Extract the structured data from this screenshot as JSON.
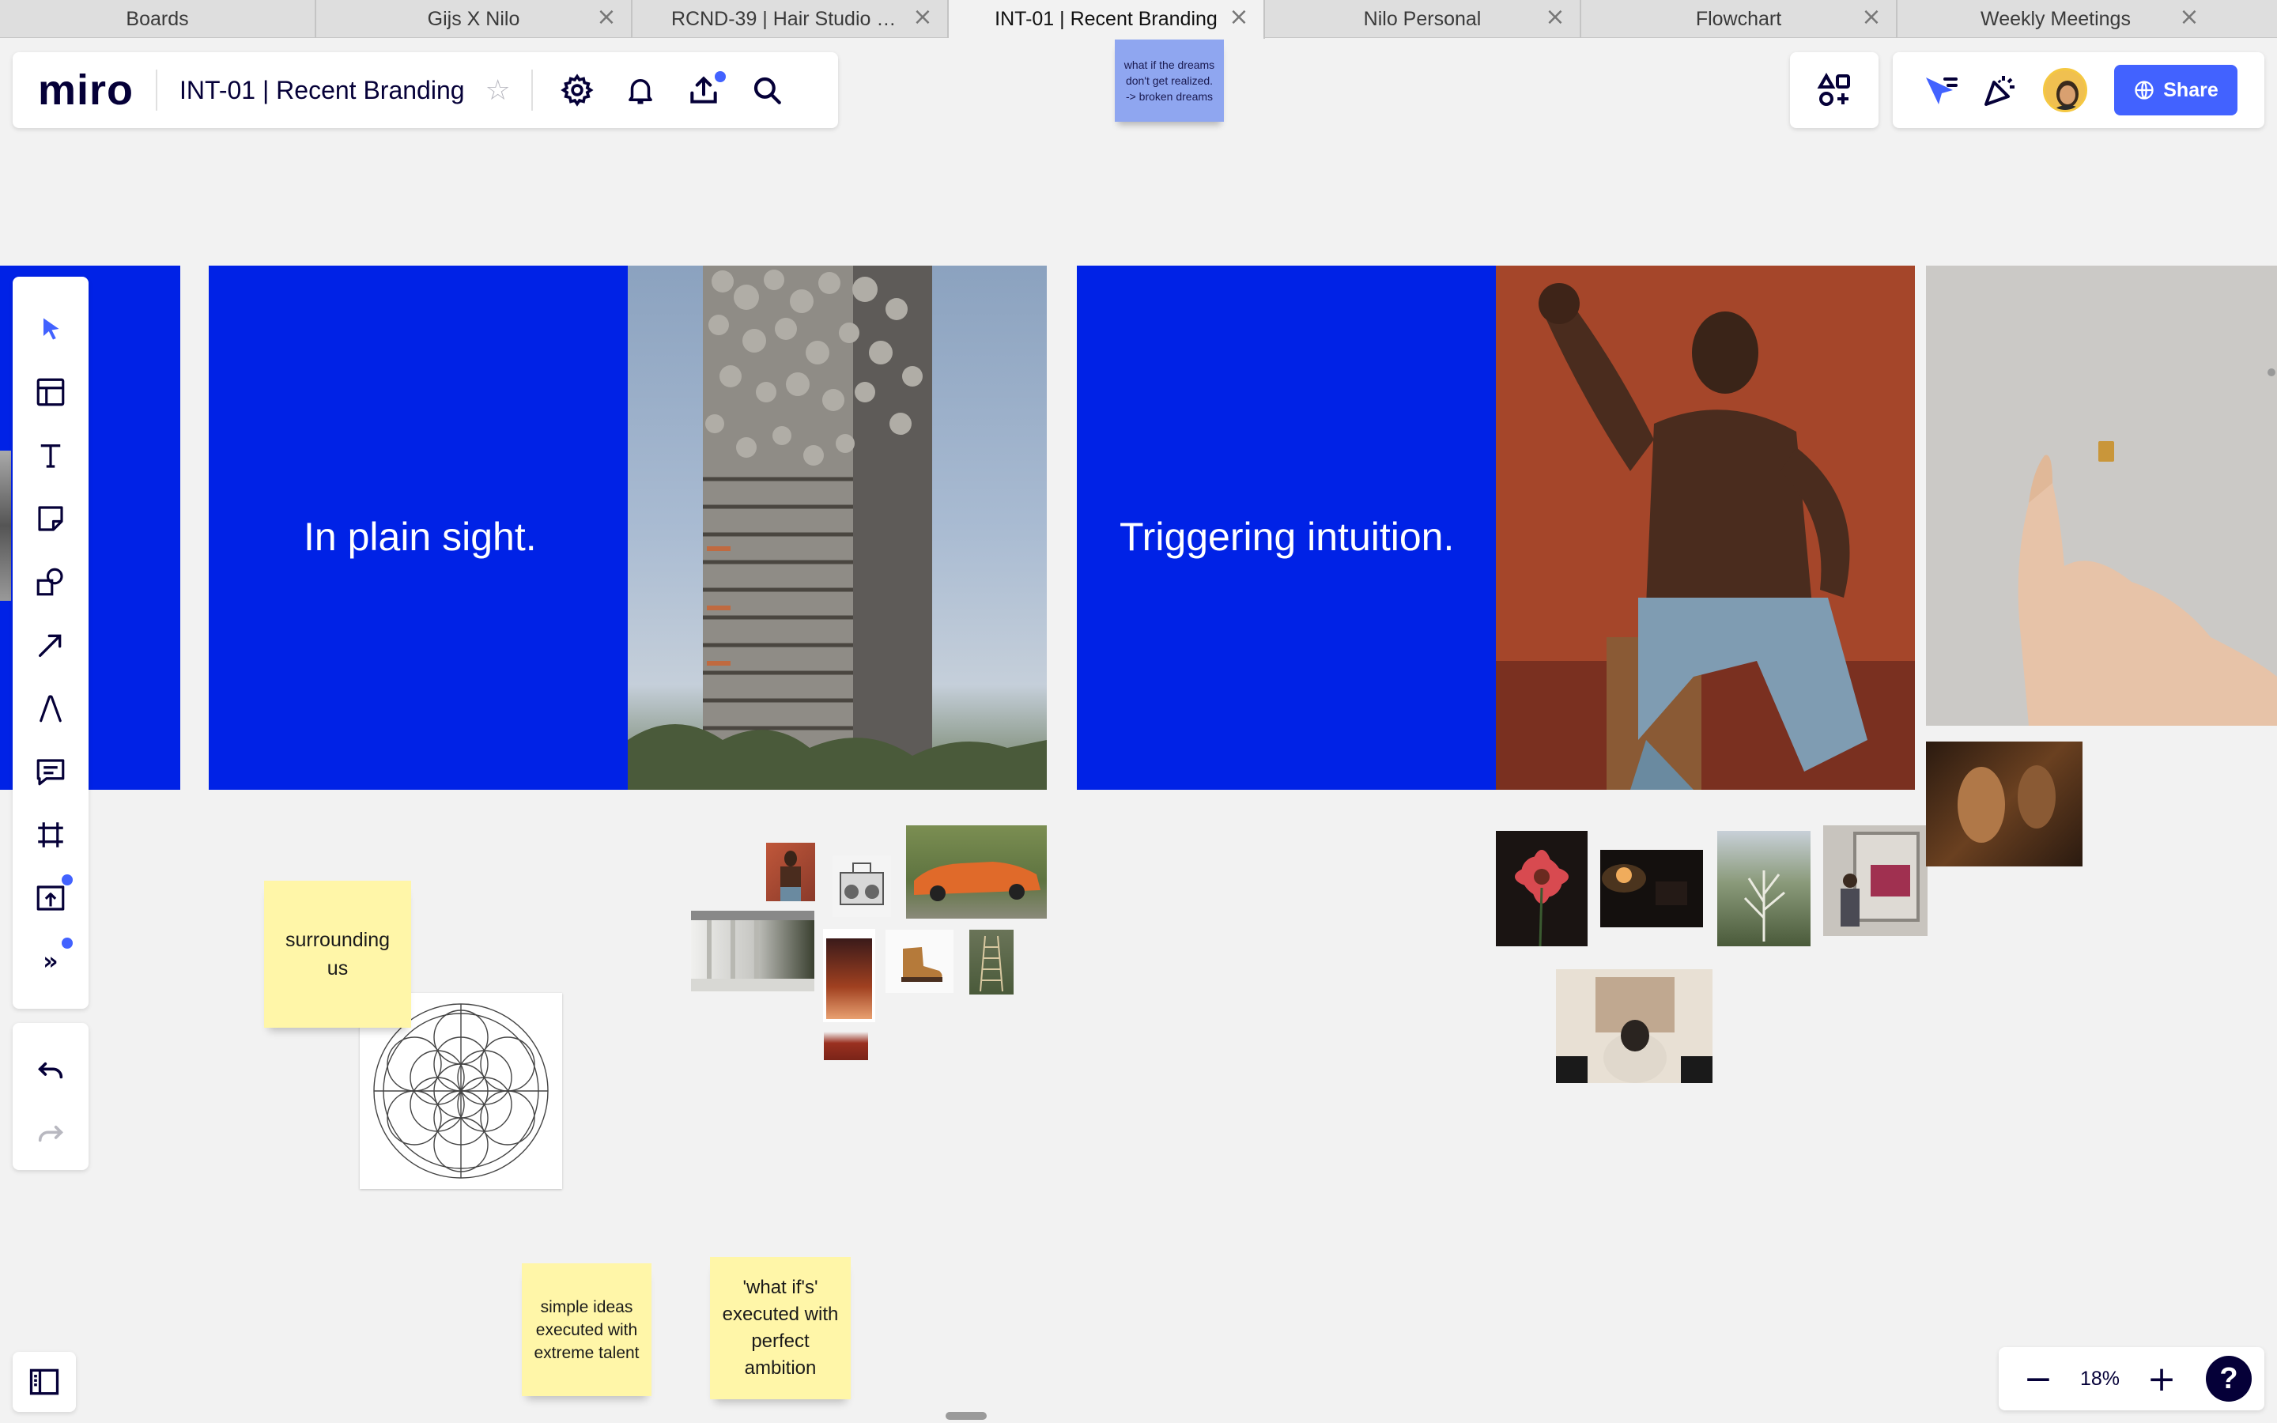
{
  "tabs": [
    {
      "label": "Boards",
      "active": false,
      "closable": false
    },
    {
      "label": "Gijs X Nilo",
      "active": false,
      "closable": true
    },
    {
      "label": "RCND-39 | Hair Studio Br...",
      "active": false,
      "closable": true
    },
    {
      "label": "INT-01 | Recent Branding",
      "active": true,
      "closable": true
    },
    {
      "label": "Nilo Personal",
      "active": false,
      "closable": true
    },
    {
      "label": "Flowchart",
      "active": false,
      "closable": true
    },
    {
      "label": "Weekly Meetings",
      "active": false,
      "closable": true
    }
  ],
  "header": {
    "logo": "miro",
    "board_title": "INT-01 | Recent Branding",
    "star_icon": "star-icon",
    "icons": [
      "gear-icon",
      "bell-icon",
      "upload-icon",
      "search-icon"
    ]
  },
  "right_header": {
    "apps_icon": "apps-icon",
    "icons": [
      "cursor-follow-icon",
      "celebrate-icon",
      "avatar"
    ],
    "share_label": "Share"
  },
  "toolbar": {
    "tools": [
      "select-tool",
      "templates-tool",
      "text-tool",
      "sticky-note-tool",
      "shapes-tool",
      "arrow-tool",
      "pen-tool",
      "comment-tool",
      "frame-tool",
      "upload-tool",
      "more-tools"
    ]
  },
  "canvas": {
    "floating_note": "what if the dreams don't get realized. -> broken dreams",
    "frames": [
      {
        "text": "In plain sight."
      },
      {
        "text": "Triggering intuition."
      }
    ],
    "stickies": [
      {
        "text": "surrounding us"
      },
      {
        "text": "simple ideas executed with extreme talent"
      },
      {
        "text": "'what if's' executed with perfect ambition"
      }
    ]
  },
  "zoom": {
    "value": "18%",
    "minus": "−",
    "plus": "+",
    "help": "?"
  },
  "colors": {
    "frame_blue": "#0022e6",
    "accent": "#4262ff",
    "sticky_yellow": "#fff6a8",
    "note_blue": "#8fa6f0"
  }
}
